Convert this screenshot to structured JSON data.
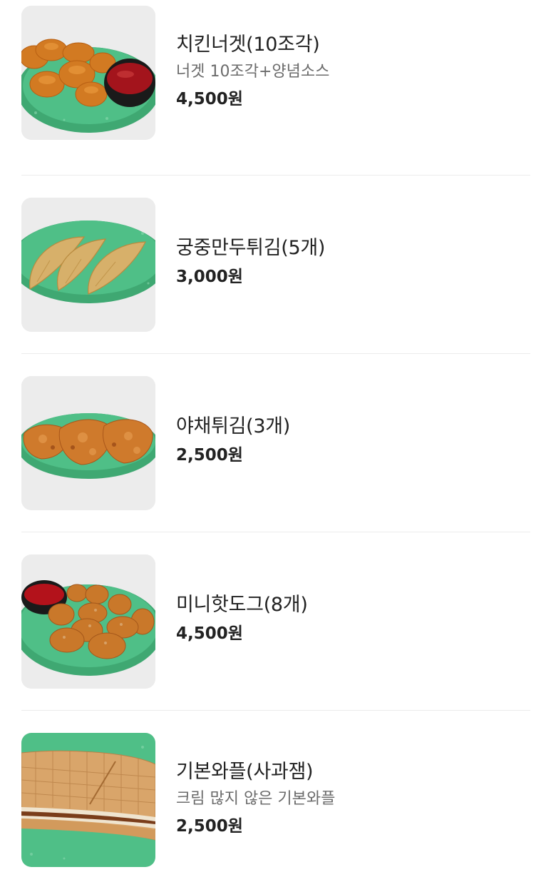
{
  "items": [
    {
      "name": "치킨너겟(10조각)",
      "description": "너겟 10조각+양념소스",
      "price": "4,500원",
      "image_icon": "chicken-nugget-photo"
    },
    {
      "name": "궁중만두튀김(5개)",
      "price": "3,000원",
      "image_icon": "fried-dumpling-photo"
    },
    {
      "name": "야채튀김(3개)",
      "price": "2,500원",
      "image_icon": "vegetable-fritter-photo"
    },
    {
      "name": "미니핫도그(8개)",
      "price": "4,500원",
      "image_icon": "mini-hotdog-photo"
    },
    {
      "name": "기본와플(사과잼)",
      "description": "크림 많지 않은 기본와플",
      "price": "2,500원",
      "image_icon": "waffle-photo"
    }
  ],
  "colors": {
    "plate": "#4fbf87",
    "photo_background": "#ececec",
    "divider": "#ececec",
    "description_text": "#6b6b6b",
    "sauce": "#a3141c"
  }
}
